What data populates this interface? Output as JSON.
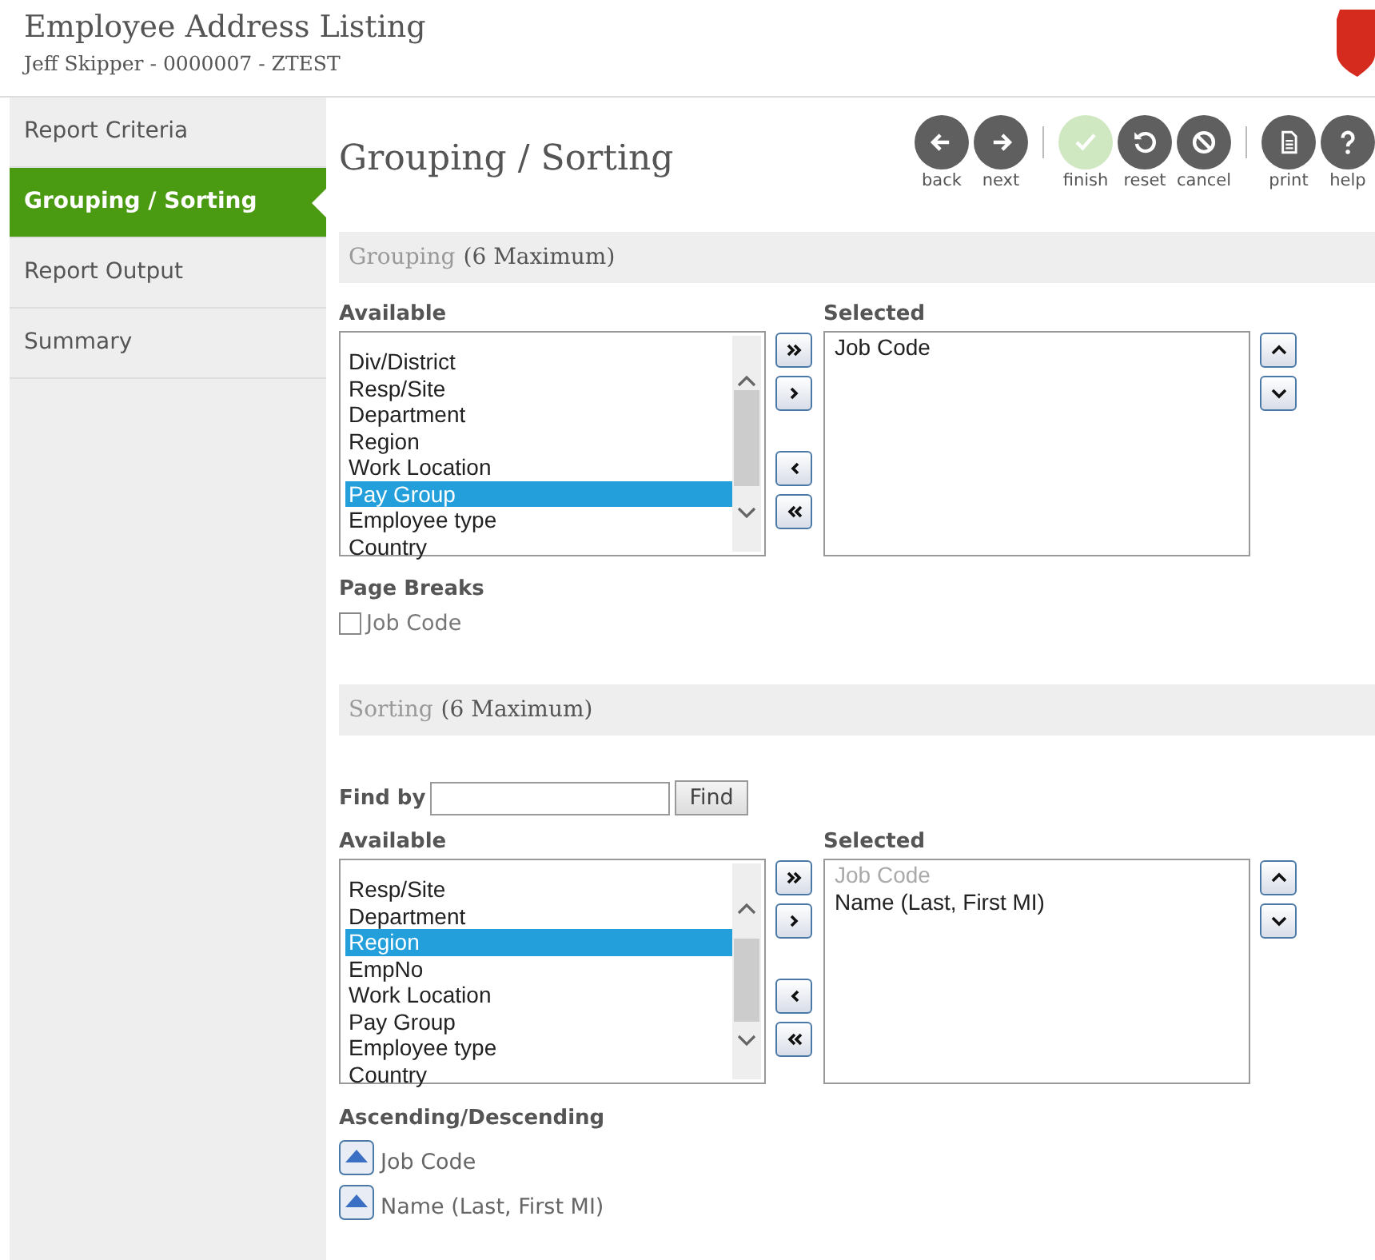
{
  "header": {
    "title": "Employee Address Listing",
    "subtitle": "Jeff Skipper - 0000007 - ZTEST"
  },
  "sidebar": {
    "items": [
      {
        "label": "Report Criteria",
        "selected": false
      },
      {
        "label": "Grouping / Sorting",
        "selected": true
      },
      {
        "label": "Report Output",
        "selected": false
      },
      {
        "label": "Summary",
        "selected": false
      }
    ]
  },
  "page_title": "Grouping / Sorting",
  "toolbar": [
    [
      {
        "kind": "back",
        "label": "back",
        "disabled": false
      },
      {
        "kind": "next",
        "label": "next",
        "disabled": false
      }
    ],
    [
      {
        "kind": "finish",
        "label": "finish",
        "disabled": true
      },
      {
        "kind": "reset",
        "label": "reset",
        "disabled": false
      },
      {
        "kind": "cancel",
        "label": "cancel",
        "disabled": false
      }
    ],
    [
      {
        "kind": "print",
        "label": "print",
        "disabled": false
      },
      {
        "kind": "help",
        "label": "help",
        "disabled": false
      }
    ]
  ],
  "grouping": {
    "title": "Grouping",
    "note": "(6 Maximum)",
    "available_label": "Available",
    "selected_label": "Selected",
    "available": [
      {
        "label": "Div/District",
        "selected": false
      },
      {
        "label": "Resp/Site",
        "selected": false
      },
      {
        "label": "Department",
        "selected": false
      },
      {
        "label": "Region",
        "selected": false
      },
      {
        "label": "Work Location",
        "selected": false
      },
      {
        "label": "Pay Group",
        "selected": true
      },
      {
        "label": "Employee type",
        "selected": false
      },
      {
        "label": "Country",
        "selected": false
      }
    ],
    "chosen": [
      {
        "label": "Job Code",
        "disabled": false
      }
    ],
    "page_breaks_label": "Page Breaks",
    "page_breaks": [
      {
        "label": "Job Code",
        "checked": false
      }
    ]
  },
  "sorting": {
    "title": "Sorting",
    "note": "(6 Maximum)",
    "find_label": "Find by",
    "find_button": "Find",
    "available_label": "Available",
    "selected_label": "Selected",
    "available": [
      {
        "label": "Resp/Site",
        "selected": false
      },
      {
        "label": "Department",
        "selected": false
      },
      {
        "label": "Region",
        "selected": true
      },
      {
        "label": "EmpNo",
        "selected": false
      },
      {
        "label": "Work Location",
        "selected": false
      },
      {
        "label": "Pay Group",
        "selected": false
      },
      {
        "label": "Employee type",
        "selected": false
      },
      {
        "label": "Country",
        "selected": false
      }
    ],
    "chosen": [
      {
        "label": "Job Code",
        "disabled": true
      },
      {
        "label": "Name (Last, First MI)",
        "disabled": false
      }
    ],
    "order_label": "Ascending/Descending",
    "order": [
      {
        "label": "Job Code",
        "ascending": true
      },
      {
        "label": "Name (Last, First MI)",
        "ascending": true
      }
    ]
  }
}
